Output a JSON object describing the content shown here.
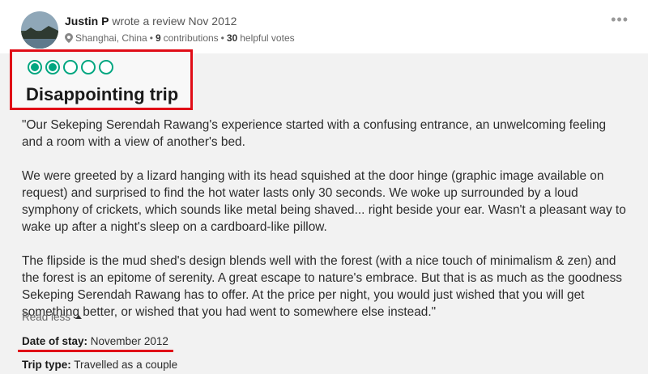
{
  "reviewer": {
    "name": "Justin P",
    "action": "wrote a review Nov 2012",
    "location": "Shanghai, China",
    "contributions_count": "9",
    "contributions_label": "contributions",
    "helpful_count": "30",
    "helpful_label": "helpful votes",
    "separator": "•",
    "more_icon": "•••"
  },
  "review": {
    "rating": 2,
    "rating_max": 5,
    "title": "Disappointing trip",
    "paragraphs": [
      "\"Our Sekeping Serendah Rawang's experience started with a confusing entrance, an unwelcoming feeling and a room with a view of another's bed.",
      "We were greeted by a lizard hanging with its head squished at the door hinge (graphic image available on request) and surprised to find the hot water lasts only 30 seconds. We woke up surrounded by a loud symphony of crickets, which sounds like metal being shaved... right beside your ear. Wasn't a pleasant way to wake up after a night's sleep on a cardboard-like pillow.",
      "The flipside is the mud shed's design blends well with the forest (with a nice touch of minimalism & zen) and the forest is an epitome of serenity. A great escape to nature's embrace. But that is as much as the goodness Sekeping Serendah Rawang has to offer. At the price per night, you would just wished that you will get something better, or wished that you had went to somewhere else instead.\""
    ],
    "read_less": "Read less",
    "date_of_stay_label": "Date of stay:",
    "date_of_stay_value": "November 2012",
    "trip_type_label": "Trip type:",
    "trip_type_value": "Travelled as a couple"
  },
  "colors": {
    "rating_green": "#00a680",
    "annotation_red": "#e00d17"
  }
}
